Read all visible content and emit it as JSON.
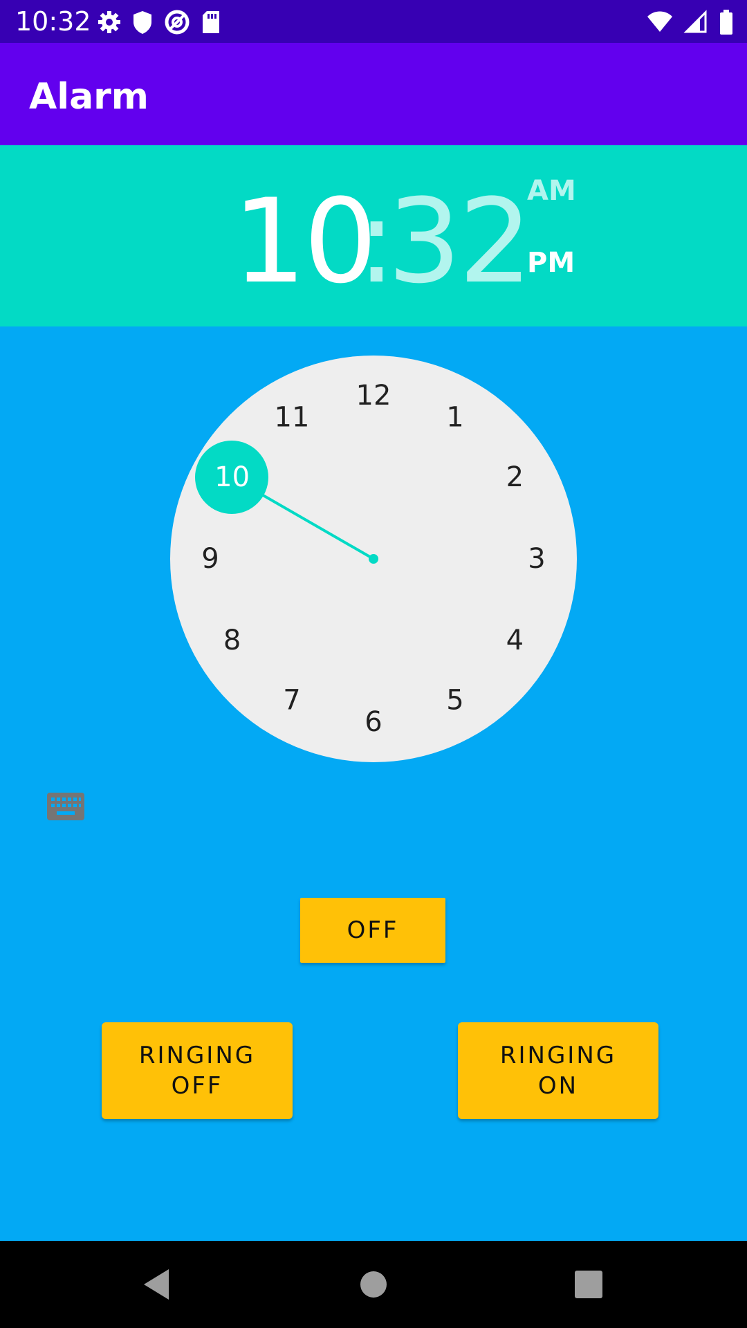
{
  "status_bar": {
    "time": "10:32",
    "icons_left": [
      "settings-icon",
      "shield-icon",
      "data-saver-icon",
      "sd-card-icon"
    ],
    "icons_right": [
      "wifi-icon",
      "signal-icon",
      "battery-icon"
    ]
  },
  "app_bar": {
    "title": "Alarm"
  },
  "time_picker": {
    "hour": "10",
    "separator": ":",
    "minute": "32",
    "am_label": "AM",
    "pm_label": "PM",
    "selected_period": "PM",
    "clock_numbers": [
      "12",
      "1",
      "2",
      "3",
      "4",
      "5",
      "6",
      "7",
      "8",
      "9",
      "10",
      "11"
    ],
    "selected_hour": "10",
    "toggle_input_icon": "keyboard-icon"
  },
  "buttons": {
    "off": "OFF",
    "ringing_off": "RINGING\nOFF",
    "ringing_on": "RINGING\nON"
  },
  "nav_bar": {
    "icons": [
      "back-icon",
      "home-icon",
      "recents-icon"
    ]
  },
  "colors": {
    "status_bar": "#3700B3",
    "app_bar": "#6200EE",
    "header": "#03DAC5",
    "background": "#03A9F4",
    "clock_face": "#EEEEEE",
    "accent": "#03DAC5",
    "button": "#FFC107"
  }
}
